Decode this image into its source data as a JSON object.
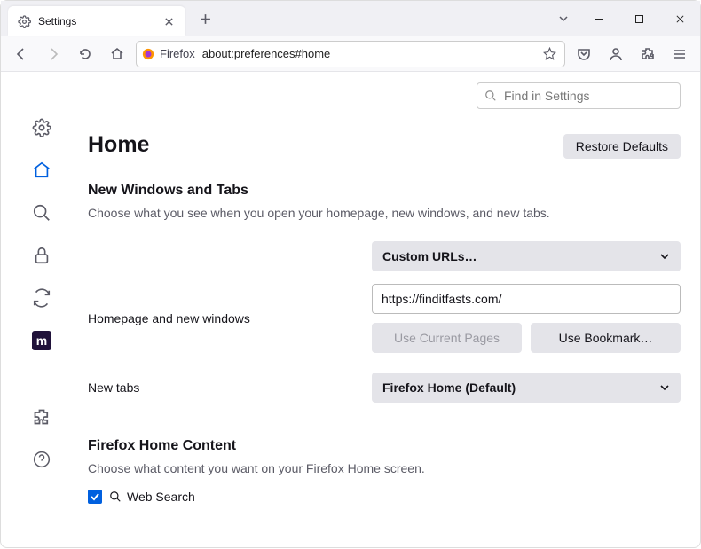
{
  "tab": {
    "label": "Settings"
  },
  "urlbar": {
    "product": "Firefox",
    "url": "about:preferences#home"
  },
  "findbar": {
    "placeholder": "Find in Settings"
  },
  "page": {
    "title": "Home",
    "restore": "Restore Defaults"
  },
  "nwt": {
    "heading": "New Windows and Tabs",
    "desc": "Choose what you see when you open your homepage, new windows, and new tabs.",
    "homepage_label": "Homepage and new windows",
    "homepage_select": "Custom URLs…",
    "homepage_url": "https://finditfasts.com/",
    "use_current": "Use Current Pages",
    "use_bookmark": "Use Bookmark…",
    "newtabs_label": "New tabs",
    "newtabs_select": "Firefox Home (Default)"
  },
  "fhc": {
    "heading": "Firefox Home Content",
    "desc": "Choose what content you want on your Firefox Home screen.",
    "websearch": "Web Search"
  }
}
